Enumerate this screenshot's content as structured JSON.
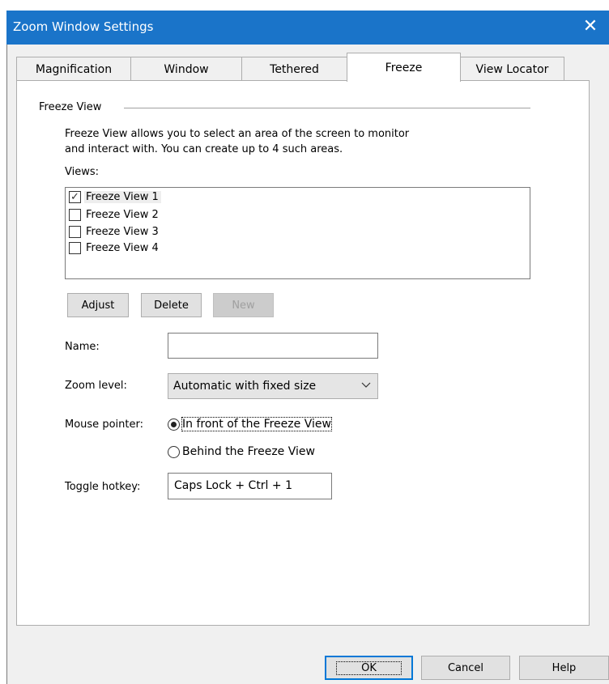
{
  "window": {
    "title": "Zoom Window Settings"
  },
  "tabs": [
    {
      "label": "Magnification"
    },
    {
      "label": "Window"
    },
    {
      "label": "Tethered"
    },
    {
      "label": "Freeze",
      "active": true
    },
    {
      "label": "View Locator"
    }
  ],
  "freeze": {
    "group_title": "Freeze View",
    "description_line1": "Freeze View allows you to select an area of the screen to monitor",
    "description_line2": "and interact with. You can create up to 4 such areas.",
    "views_label": "Views:",
    "views": [
      {
        "label": "Freeze View 1",
        "checked": true
      },
      {
        "label": "Freeze View 2",
        "checked": false
      },
      {
        "label": "Freeze View 3",
        "checked": false
      },
      {
        "label": "Freeze View 4",
        "checked": false
      }
    ],
    "buttons": {
      "adjust": "Adjust",
      "delete": "Delete",
      "new": "New"
    },
    "name_label": "Name:",
    "name_value": "",
    "zoom_label": "Zoom level:",
    "zoom_value": "Automatic with fixed size",
    "pointer_label": "Mouse pointer:",
    "pointer_options": [
      {
        "label": "In front of the Freeze View",
        "selected": true
      },
      {
        "label": "Behind the Freeze View",
        "selected": false
      }
    ],
    "hotkey_label": "Toggle hotkey:",
    "hotkey_value": "Caps Lock + Ctrl + 1"
  },
  "footer": {
    "ok": "OK",
    "cancel": "Cancel",
    "help": "Help"
  },
  "icons": {
    "close": "close-icon",
    "check": "checkmark-icon",
    "dropdown": "chevron-down-icon"
  },
  "colors": {
    "titlebar": "#1a74c9",
    "focus_border": "#0078d7"
  }
}
